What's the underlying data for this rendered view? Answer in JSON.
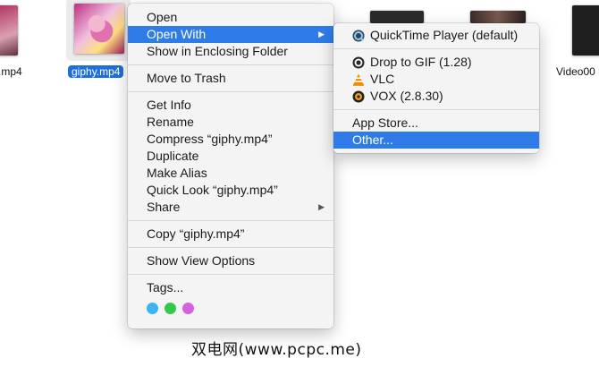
{
  "desktop": {
    "files": [
      {
        "label": ".mp4",
        "selected": false
      },
      {
        "label": "giphy.mp4",
        "selected": true
      },
      {
        "label": "Video00",
        "selected": false
      }
    ]
  },
  "context_menu": {
    "open": "Open",
    "open_with": "Open With",
    "show_in_folder": "Show in Enclosing Folder",
    "move_to_trash": "Move to Trash",
    "get_info": "Get Info",
    "rename": "Rename",
    "compress": "Compress “giphy.mp4”",
    "duplicate": "Duplicate",
    "make_alias": "Make Alias",
    "quick_look": "Quick Look “giphy.mp4”",
    "share": "Share",
    "copy": "Copy “giphy.mp4”",
    "show_view_options": "Show View Options",
    "tags": "Tags...",
    "tag_colors": [
      "#3ab4f2",
      "#34c84a",
      "#d462e0"
    ]
  },
  "open_with_submenu": {
    "items": [
      {
        "label": "QuickTime Player (default)",
        "icon": "quicktime-icon"
      },
      {
        "label": "Drop to GIF (1.28)",
        "icon": "drop-to-gif-icon"
      },
      {
        "label": "VLC",
        "icon": "vlc-icon"
      },
      {
        "label": "VOX (2.8.30)",
        "icon": "vox-icon"
      }
    ],
    "app_store": "App Store...",
    "other": "Other..."
  },
  "watermark": "双电网(www.pcpc.me)",
  "colors": {
    "highlight": "#2f7ce9",
    "selection_label": "#1f6fd8"
  }
}
